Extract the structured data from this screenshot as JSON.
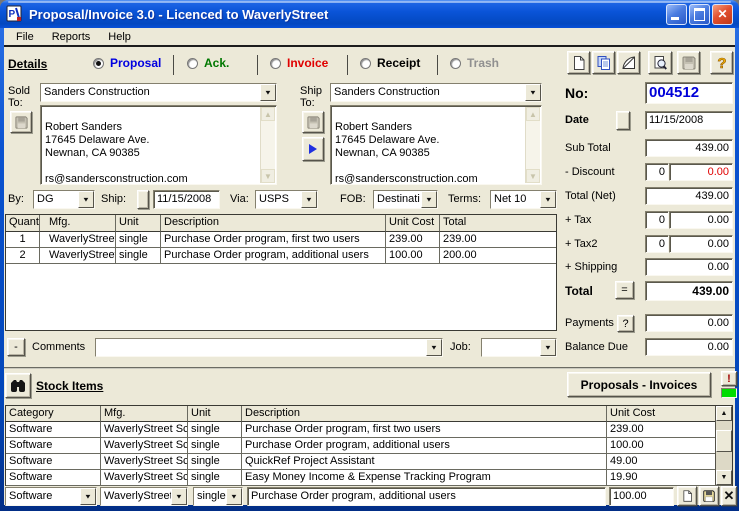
{
  "window": {
    "title": "Proposal/Invoice 3.0 - Licenced to WaverlyStreet"
  },
  "menu": {
    "file": "File",
    "reports": "Reports",
    "help": "Help"
  },
  "modes": {
    "section_label": "Details",
    "proposal": "Proposal",
    "ack": "Ack.",
    "invoice": "Invoice",
    "receipt": "Receipt",
    "trash": "Trash",
    "selected": "Proposal"
  },
  "sold_to": {
    "label": "Sold To:",
    "company": "Sanders Construction",
    "address": "Robert Sanders\n17645 Delaware Ave.\nNewnan, CA 90385\n\nrs@sandersconstruction.com"
  },
  "ship_to": {
    "label": "Ship To:",
    "company": "Sanders Construction",
    "address": "Robert Sanders\n17645 Delaware Ave.\nNewnan, CA 90385\n\nrs@sandersconstruction.com"
  },
  "summary": {
    "no_label": "No:",
    "no": "004512",
    "date_label": "Date",
    "date": "11/15/2008",
    "subtotal_label": "Sub Total",
    "subtotal": "439.00",
    "discount_label": "- Discount",
    "discount_rate": "0",
    "discount": "0.00",
    "totalnet_label": "Total (Net)",
    "totalnet": "439.00",
    "tax_label": "+ Tax",
    "tax_rate": "0",
    "tax": "0.00",
    "tax2_label": "+ Tax2",
    "tax2_rate": "0",
    "tax2": "0.00",
    "shipping_label": "+ Shipping",
    "shipping": "0.00",
    "total_label": "Total",
    "equals": "=",
    "total": "439.00",
    "payments_label": "Payments",
    "payments_help": "?",
    "payments": "0.00",
    "balance_label": "Balance Due",
    "balance": "0.00"
  },
  "dispatch": {
    "by_label": "By:",
    "by": "DG",
    "ship_label": "Ship:",
    "date": "11/15/2008",
    "via_label": "Via:",
    "via": "USPS",
    "fob_label": "FOB:",
    "fob": "Destinati",
    "terms_label": "Terms:",
    "terms": "Net 10"
  },
  "line_items": {
    "headers": [
      "Quant",
      "",
      "Mfg.",
      "Unit",
      "Description",
      "Unit Cost",
      "Total"
    ],
    "rows": [
      [
        "1",
        "",
        "WaverlyStreet",
        "single",
        "Purchase Order program, first two users",
        "239.00",
        "239.00"
      ],
      [
        "2",
        "",
        "WaverlyStreet",
        "single",
        "Purchase Order program, additional users",
        "100.00",
        "200.00"
      ]
    ]
  },
  "comments": {
    "collapse_button": "-",
    "label": "Comments",
    "value": "",
    "job_label": "Job:",
    "job": ""
  },
  "stock": {
    "title": "Stock Items",
    "nav_button": "Proposals - Invoices",
    "alert": "!",
    "headers": [
      "Category",
      "Mfg.",
      "Unit",
      "Description",
      "Unit Cost"
    ],
    "rows": [
      [
        "Software",
        "WaverlyStreet Sc",
        "single",
        "Purchase Order program, first two users",
        "239.00"
      ],
      [
        "Software",
        "WaverlyStreet Sc",
        "single",
        "Purchase Order program, additional users",
        "100.00"
      ],
      [
        "Software",
        "WaverlyStreet Sc",
        "single",
        "QuickRef Project Assistant",
        "49.00"
      ],
      [
        "Software",
        "WaverlyStreet Sc",
        "single",
        "Easy Money Income & Expense Tracking Program",
        "19.90"
      ]
    ]
  },
  "entry": {
    "category": "Software",
    "mfg": "WaverlyStreet",
    "unit": "single",
    "description": "Purchase Order program, additional users",
    "unit_cost": "100.00"
  },
  "colors": {
    "title_blue": "#0A54D8",
    "number_blue": "#0000D8",
    "amount_red": "#E00000",
    "mode_proposal": "#0000E0",
    "mode_ack": "#007800",
    "mode_invoice": "#E00000",
    "mode_receipt": "#000000",
    "mode_trash": "#909090",
    "indicator_green": "#00DC00"
  }
}
